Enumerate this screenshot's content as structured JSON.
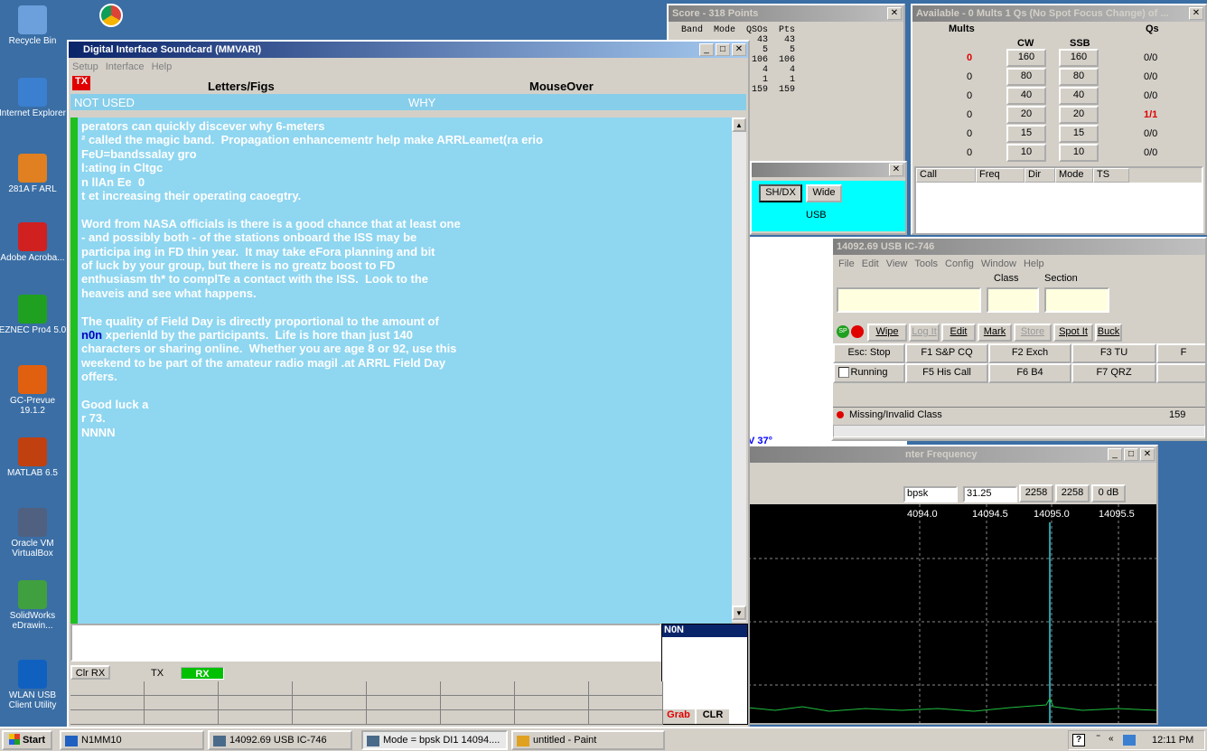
{
  "desktop": {
    "icons": [
      {
        "label": "Recycle Bin",
        "color": "#6ca0dc"
      },
      {
        "label": "Internet Explorer",
        "color": "#3a7fd0"
      },
      {
        "label": "281A F ARL",
        "color": "#e08020"
      },
      {
        "label": "Adobe Acroba...",
        "color": "#d02020"
      },
      {
        "label": "EZNEC Pro4 5.0",
        "color": "#20a020"
      },
      {
        "label": "GC-Prevue 19.1.2",
        "color": "#e06010"
      },
      {
        "label": "MATLAB 6.5",
        "color": "#c04010"
      },
      {
        "label": "Oracle VM VirtualBox",
        "color": "#506080"
      },
      {
        "label": "SolidWorks eDrawin...",
        "color": "#40a040"
      },
      {
        "label": "WLAN USB Client Utility",
        "color": "#1060c0"
      }
    ]
  },
  "score": {
    "title": "Score - 318 Points",
    "headers": [
      "Band",
      "Mode",
      "QSOs",
      "Pts"
    ],
    "rows": [
      [
        "",
        "",
        "43",
        "43"
      ],
      [
        "",
        "",
        "5",
        "5"
      ],
      [
        "",
        "",
        "106",
        "106"
      ],
      [
        "",
        "",
        "4",
        "4"
      ],
      [
        "",
        "",
        "1",
        "1"
      ],
      [
        "",
        "",
        "159",
        "159"
      ]
    ]
  },
  "avail": {
    "title": "Available - 0 Mults 1 Qs  (No Spot Focus Change) of ...",
    "h_mults": "Mults",
    "h_qs": "Qs",
    "h_cw": "CW",
    "h_ssb": "SSB",
    "rows": [
      {
        "m": "0",
        "cw": "160",
        "ssb": "160",
        "q": "0/0",
        "red": true,
        "qred": false
      },
      {
        "m": "0",
        "cw": "80",
        "ssb": "80",
        "q": "0/0",
        "red": false,
        "qred": false
      },
      {
        "m": "0",
        "cw": "40",
        "ssb": "40",
        "q": "0/0",
        "red": false,
        "qred": false
      },
      {
        "m": "0",
        "cw": "20",
        "ssb": "20",
        "q": "1/1",
        "red": false,
        "qred": true
      },
      {
        "m": "0",
        "cw": "15",
        "ssb": "15",
        "q": "0/0",
        "red": false,
        "qred": false
      },
      {
        "m": "0",
        "cw": "10",
        "ssb": "10",
        "q": "0/0",
        "red": false,
        "qred": false
      }
    ],
    "cols": [
      "Call",
      "Freq",
      "Dir",
      "Mode",
      "TS"
    ]
  },
  "bandmap": {
    "sh_dx": "SH/DX",
    "wide": "Wide",
    "mode": "USB"
  },
  "mm": {
    "title": "Digital Interface Soundcard (MMVARI)",
    "menu": [
      "Setup",
      "Interface",
      "Help"
    ],
    "tx": "TX",
    "letters": "Letters/Figs",
    "mouseover": "MouseOver",
    "not_used": "NOT USED",
    "why": "WHY",
    "lines": [
      "perators can quickly discever why 6-meters",
      "² called the magic band.  Propagation enhancementr help make ARRLeamet(ra erio",
      "FeU=bandssalay gro",
      "l:ating in Cltgc",
      "n llAn Ee  0",
      "t et increasing their operating caoegtry.",
      "",
      "Word from NASA officials is there is a good chance that at least one",
      "- and possibly both - of the stations onboard the ISS may be",
      "participa ing in FD thin year.  It may take eFora planning and bit",
      "of luck by your group, but there is no greatz boost to FD",
      "enthusiasm th* to complTe a contact with the ISS.  Look to the",
      "heaveis and see what happens.",
      "",
      "The quality of Field Day is directly proportional to the amount of",
      "##n0n## xperienld by the participants.  Life is hore than just 140",
      "characters or sharing online.  Whether you are age 8 or 92, use this",
      "weekend to be part of the amateur radio magil .at ARRL Field Day",
      "offers.",
      "",
      "Good luck a",
      "r 73.",
      "NNNN"
    ],
    "side_call": "N0N",
    "clr_rx": "Clr RX",
    "tx_btn": "TX",
    "rx_btn": "RX",
    "grab": "Grab",
    "clr": "CLR"
  },
  "entry": {
    "title": "14092.69 USB IC-746",
    "menu": [
      "File",
      "Edit",
      "View",
      "Tools",
      "Config",
      "Window",
      "Help"
    ],
    "class_label": "Class",
    "section_label": "Section",
    "btns": [
      "Wipe",
      "Log It",
      "Edit",
      "Mark",
      "Store",
      "Spot It",
      "Buck"
    ],
    "fkeys1": [
      "Esc: Stop",
      "F1 S&P CQ",
      "F2 Exch",
      "F3 TU",
      "F"
    ],
    "fkeys2": [
      "Running",
      "F5 His Call",
      "F6 B4",
      "F7 QRZ",
      ""
    ],
    "status": "Missing/Invalid Class",
    "count": "159",
    "sp": "SP"
  },
  "spectrum": {
    "title": "nter Frequency",
    "mode": "bpsk",
    "bw": "31.25",
    "v1": "2258",
    "v2": "2258",
    "gain": "0 dB",
    "ticks": [
      "4094.0",
      "14094.5",
      "14095.0",
      "14095.5"
    ],
    "readout": "V 37°"
  },
  "taskbar": {
    "start": "Start",
    "tasks": [
      "N1MM10",
      "14092.69 USB IC-746",
      "Mode = bpsk DI1 14094....",
      "untitled - Paint"
    ],
    "time": "12:11 PM"
  }
}
